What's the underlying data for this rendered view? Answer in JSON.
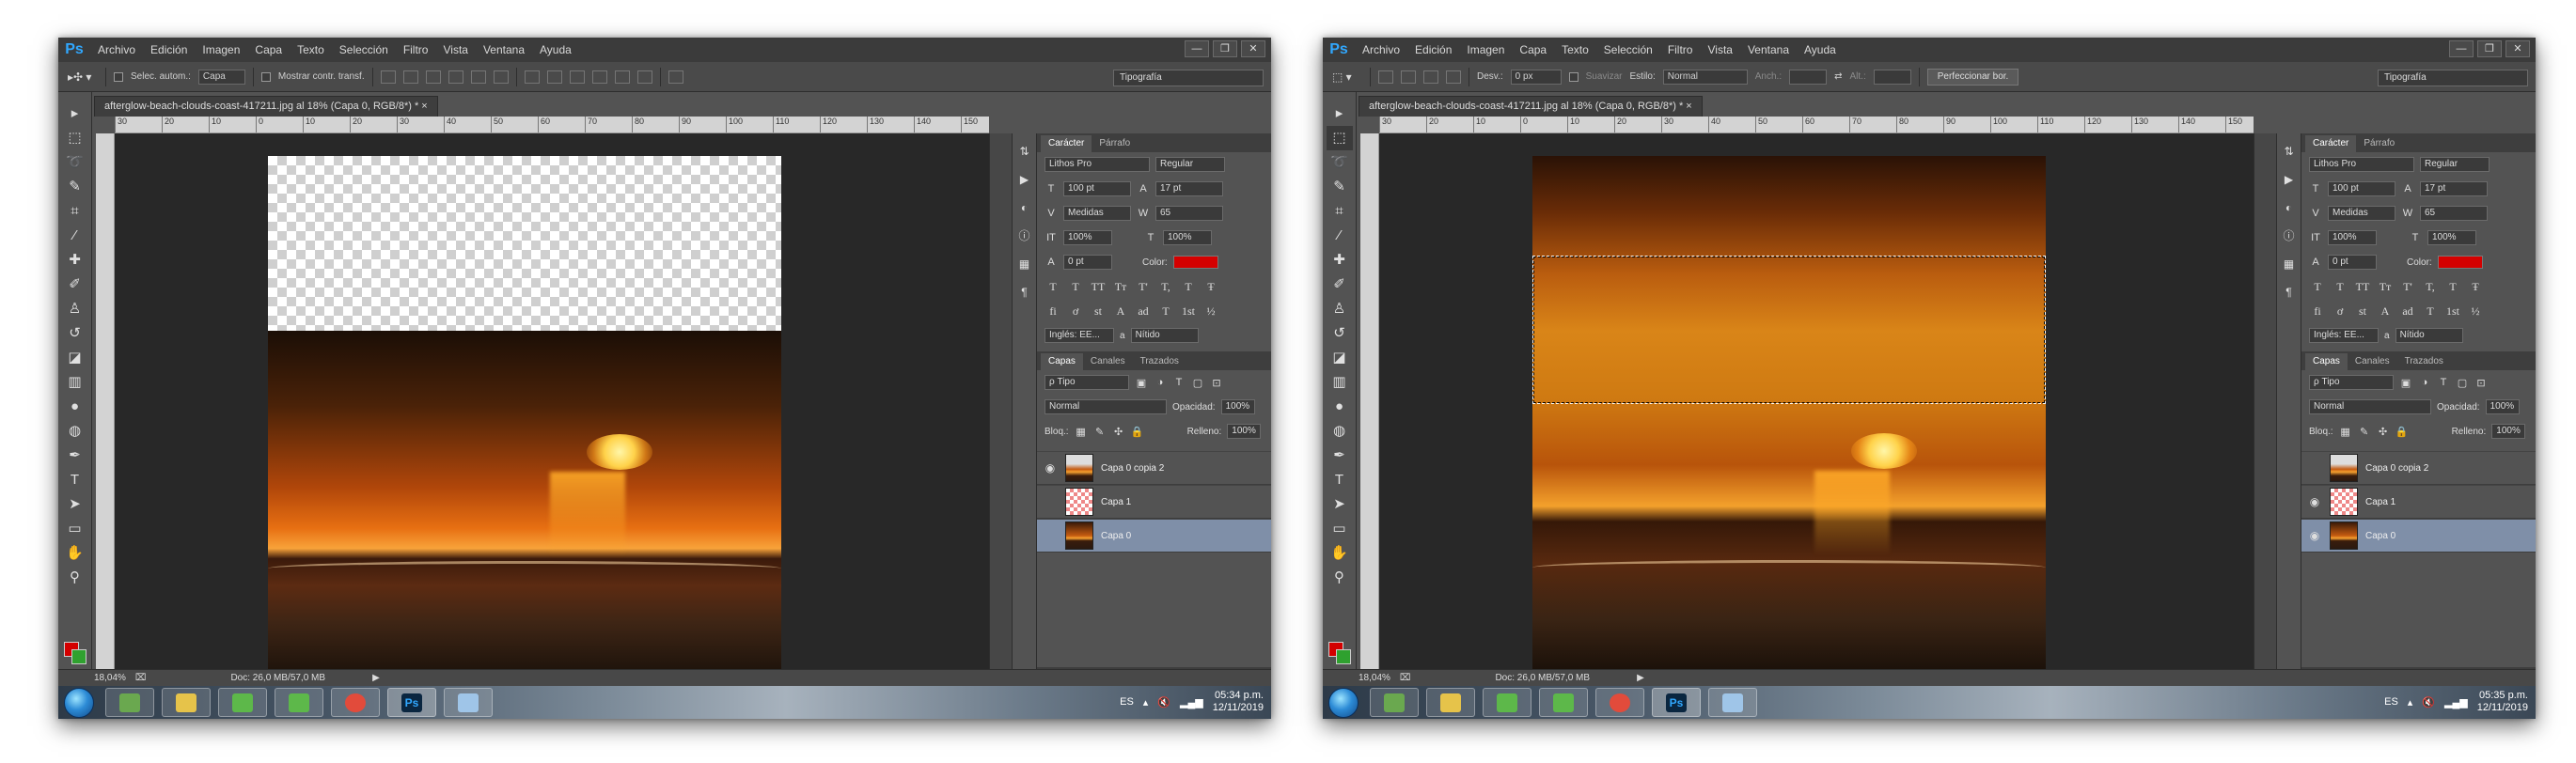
{
  "menu": [
    "Archivo",
    "Edición",
    "Imagen",
    "Capa",
    "Texto",
    "Selección",
    "Filtro",
    "Vista",
    "Ventana",
    "Ayuda"
  ],
  "window_controls": [
    "—",
    "❐",
    "✕"
  ],
  "workspace": "Tipografía",
  "left": {
    "options": {
      "tool_icon": "move-tool-icon",
      "auto_select_label": "Selec. autom.:",
      "auto_select_value": "Capa",
      "show_transform_label": "Mostrar contr. transf."
    },
    "doc_tab": "afterglow-beach-clouds-coast-417211.jpg al 18% (Capa 0, RGB/8*) * ×",
    "status_zoom": "18,04%",
    "status_doc": "Doc: 26,0 MB/57,0 MB",
    "clock_time": "05:34 p.m.",
    "clock_date": "12/11/2019",
    "layers_blend": "Normal",
    "layers_opacity_label": "Opacidad:",
    "layers_opacity": "100%",
    "layers_lock_label": "Bloq.:",
    "layers_fill_label": "Relleno:",
    "layers_fill": "100%",
    "layers": [
      {
        "name": "Capa 0 copia 2",
        "visible": true,
        "selected": false
      },
      {
        "name": "Capa 1",
        "visible": false,
        "selected": false
      },
      {
        "name": "Capa 0",
        "visible": false,
        "selected": true
      }
    ]
  },
  "right": {
    "options": {
      "tool_icon": "marquee-tool-icon",
      "feather_label": "Desv.:",
      "feather_value": "0 px",
      "smooth_label": "Suavizar",
      "style_label": "Estilo:",
      "style_value": "Normal",
      "width_label": "Anch.:",
      "height_label": "Alt.:",
      "refine_button": "Perfeccionar bor."
    },
    "doc_tab": "afterglow-beach-clouds-coast-417211.jpg al 18% (Capa 0, RGB/8*) * ×",
    "status_zoom": "18,04%",
    "status_doc": "Doc: 26,0 MB/57,0 MB",
    "clock_time": "05:35 p.m.",
    "clock_date": "12/11/2019",
    "layers_blend": "Normal",
    "layers_opacity_label": "Opacidad:",
    "layers_opacity": "100%",
    "layers_lock_label": "Bloq.:",
    "layers_fill_label": "Relleno:",
    "layers_fill": "100%",
    "layers": [
      {
        "name": "Capa 0 copia 2",
        "visible": false,
        "selected": false
      },
      {
        "name": "Capa 1",
        "visible": true,
        "selected": false
      },
      {
        "name": "Capa 0",
        "visible": true,
        "selected": true
      }
    ]
  },
  "ruler_ticks": [
    "30",
    "20",
    "10",
    "0",
    "10",
    "20",
    "30",
    "40",
    "50",
    "60",
    "70",
    "80",
    "90",
    "100",
    "110",
    "120",
    "130",
    "140",
    "150"
  ],
  "character": {
    "tabs": [
      "Carácter",
      "Párrafo"
    ],
    "font": "Lithos Pro",
    "style": "Regular",
    "size": "100 pt",
    "leading": "17 pt",
    "kerning": "Medidas",
    "tracking": "65",
    "vscale": "100%",
    "hscale": "100%",
    "baseline": "0 pt",
    "color_label": "Color:",
    "color_value": "#d40000",
    "typo_buttons": [
      "T",
      "T",
      "TT",
      "Tт",
      "T'",
      "T,",
      "T",
      "Ŧ"
    ],
    "ot_buttons": [
      "fi",
      "ơ",
      "st",
      "A",
      "ad",
      "T",
      "1st",
      "½"
    ],
    "language": "Inglés: EE...",
    "aa_label": "a",
    "aa_value": "Nítido"
  },
  "layers_tabs": [
    "Capas",
    "Canales",
    "Trazados"
  ],
  "layers_filter": "ρ Tipo",
  "taskbar": {
    "lang": "ES"
  },
  "colors": {
    "fg": "#d40000",
    "bg": "#2fa12f",
    "accent": "#31a8ff"
  }
}
